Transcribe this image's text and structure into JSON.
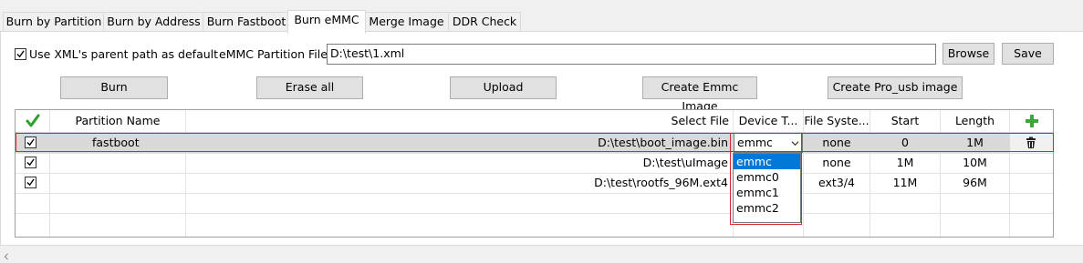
{
  "tabs": [
    {
      "label": "Burn by Partition"
    },
    {
      "label": "Burn by Address"
    },
    {
      "label": "Burn Fastboot"
    },
    {
      "label": "Burn eMMC"
    },
    {
      "label": "Merge Image"
    },
    {
      "label": "DDR Check"
    }
  ],
  "active_tab": "Burn eMMC",
  "options": {
    "use_xml_parent": {
      "label": "Use XML's parent path as default",
      "checked": true
    },
    "partition_file_label": "eMMC Partition File",
    "partition_file_value": "D:\\test\\1.xml",
    "browse_label": "Browse",
    "save_label": "Save"
  },
  "actions": {
    "burn": "Burn",
    "erase_all": "Erase all",
    "upload": "Upload",
    "create_emmc_image": "Create Emmc Image",
    "create_pro_usb_image": "Create Pro_usb image"
  },
  "table": {
    "headers": {
      "partition_name": "Partition Name",
      "select_file": "Select File",
      "device_type": "Device T...",
      "file_system": "File Syste...",
      "start": "Start",
      "length": "Length"
    },
    "rows": [
      {
        "checked": true,
        "name": "fastboot",
        "file": "D:\\test\\boot_image.bin",
        "device": "emmc",
        "fs": "none",
        "start": "0",
        "length": "1M"
      },
      {
        "checked": true,
        "name": "",
        "file": "D:\\test\\uImage",
        "device": "",
        "fs": "none",
        "start": "1M",
        "length": "10M"
      },
      {
        "checked": true,
        "name": "",
        "file": "D:\\test\\rootfs_96M.ext4",
        "device": "",
        "fs": "ext3/4",
        "start": "11M",
        "length": "96M"
      }
    ]
  },
  "device_dropdown": {
    "selected": "emmc",
    "options": [
      "emmc",
      "emmc0",
      "emmc1",
      "emmc2"
    ]
  },
  "colors": {
    "accent": "#0078d7",
    "highlight_border": "#d9262e",
    "check_green": "#2ea02e"
  }
}
